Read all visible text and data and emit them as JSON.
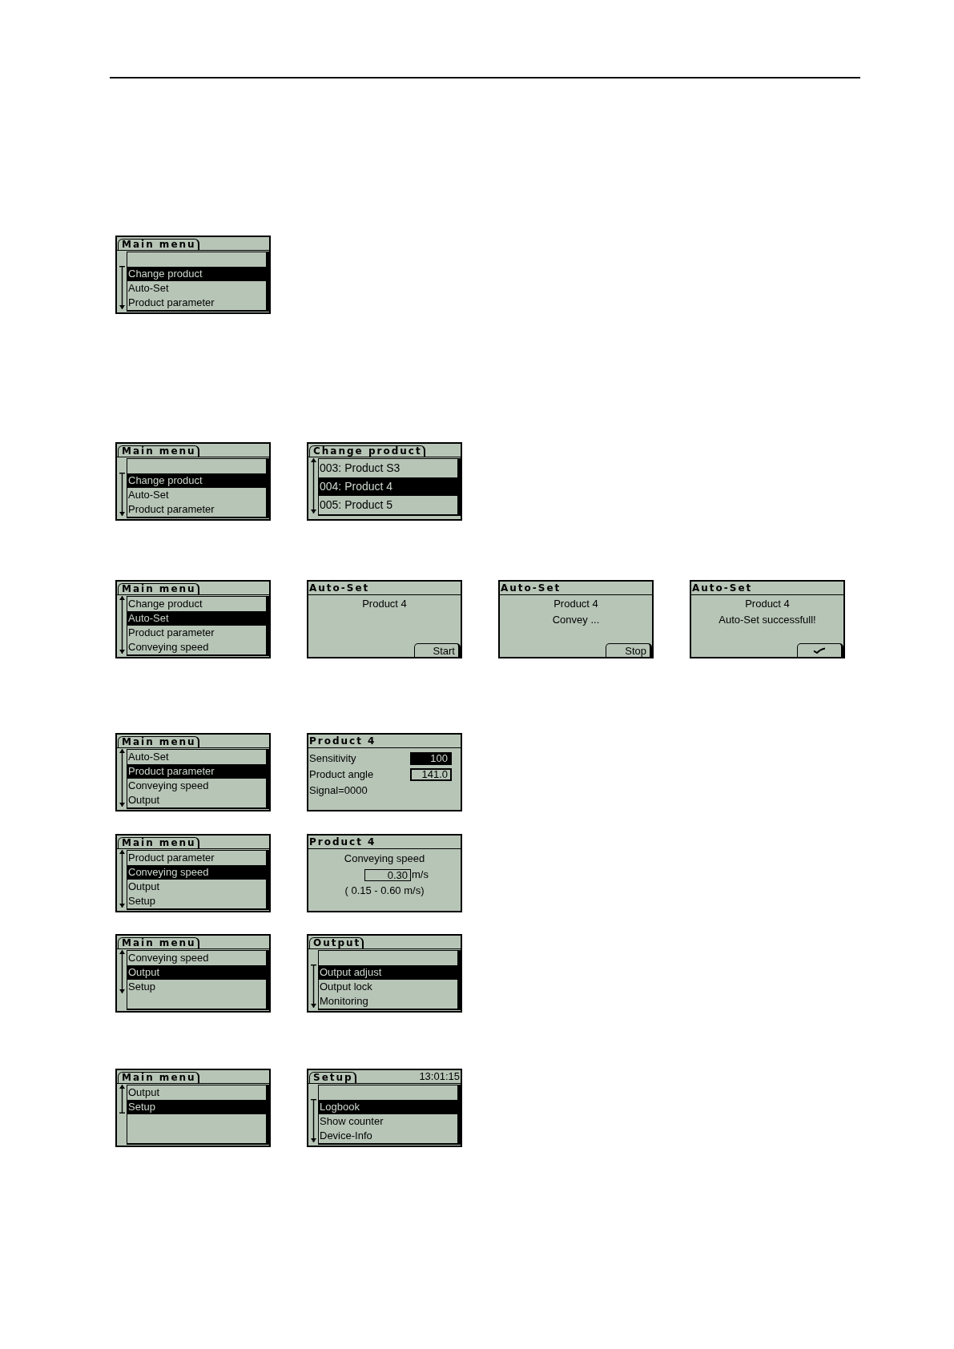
{
  "rows": [
    {
      "screens": [
        {
          "kind": "menu",
          "title": "Main menu",
          "at_top": true,
          "at_end": false,
          "items": [
            {
              "label": "Change product",
              "selected": true
            },
            {
              "label": "Auto-Set",
              "selected": false
            },
            {
              "label": "Product parameter",
              "selected": false
            }
          ]
        }
      ]
    },
    {
      "screens": [
        {
          "kind": "menu",
          "title": "Main menu",
          "at_top": true,
          "at_end": false,
          "items": [
            {
              "label": "Change product",
              "selected": true
            },
            {
              "label": "Auto-Set",
              "selected": false
            },
            {
              "label": "Product parameter",
              "selected": false
            }
          ]
        },
        {
          "kind": "list",
          "title": "Change product",
          "at_top": false,
          "at_end": false,
          "items": [
            {
              "label": "003: Product S3",
              "selected": false
            },
            {
              "label": "004: Product 4",
              "selected": true
            },
            {
              "label": "005: Product 5",
              "selected": false
            }
          ]
        }
      ]
    },
    {
      "screens": [
        {
          "kind": "menu",
          "title": "Main menu",
          "at_top": false,
          "at_end": false,
          "items": [
            {
              "label": "Change product",
              "selected": false
            },
            {
              "label": "Auto-Set",
              "selected": true
            },
            {
              "label": "Product parameter",
              "selected": false
            },
            {
              "label": "Conveying speed",
              "selected": false
            }
          ]
        },
        {
          "kind": "message",
          "title": "Auto-Set",
          "lines": [
            "Product 4"
          ],
          "button": {
            "kind": "text",
            "label": "Start"
          }
        },
        {
          "kind": "message",
          "title": "Auto-Set",
          "lines": [
            "Product 4",
            "Convey ..."
          ],
          "button": {
            "kind": "text",
            "label": "Stop"
          }
        },
        {
          "kind": "message",
          "title": "Auto-Set",
          "lines": [
            "Product 4",
            "Auto-Set successfull!"
          ],
          "button": {
            "kind": "check"
          }
        }
      ]
    },
    {
      "screens": [
        {
          "kind": "menu",
          "title": "Main menu",
          "at_top": false,
          "at_end": false,
          "items": [
            {
              "label": "Auto-Set",
              "selected": false
            },
            {
              "label": "Product parameter",
              "selected": true
            },
            {
              "label": "Conveying speed",
              "selected": false
            },
            {
              "label": "Output",
              "selected": false
            }
          ]
        },
        {
          "kind": "parameters",
          "title": "Product 4",
          "fields": [
            {
              "label": "Sensitivity",
              "value": "100",
              "selected": true
            },
            {
              "label": "Product angle",
              "value": "141.0",
              "selected": false
            }
          ],
          "lines": [
            "Signal=0000"
          ]
        }
      ]
    },
    {
      "screens": [
        {
          "kind": "menu",
          "title": "Main menu",
          "at_top": false,
          "at_end": false,
          "items": [
            {
              "label": "Product parameter",
              "selected": false
            },
            {
              "label": "Conveying speed",
              "selected": true
            },
            {
              "label": "Output",
              "selected": false
            },
            {
              "label": "Setup",
              "selected": false
            }
          ]
        },
        {
          "kind": "setting",
          "title": "Product 4",
          "caption": "Conveying speed",
          "value": "0.30",
          "unit": "m/s",
          "range": "( 0.15 - 0.60 m/s)"
        }
      ]
    },
    {
      "screens": [
        {
          "kind": "menu",
          "title": "Main menu",
          "at_top": false,
          "at_end": false,
          "items": [
            {
              "label": "Conveying speed",
              "selected": false
            },
            {
              "label": "Output",
              "selected": true
            },
            {
              "label": "Setup",
              "selected": false
            }
          ]
        },
        {
          "kind": "menu",
          "title": "Output",
          "at_top": true,
          "at_end": false,
          "items": [
            {
              "label": "Output adjust",
              "selected": true
            },
            {
              "label": "Output lock",
              "selected": false
            },
            {
              "label": "Monitoring",
              "selected": false
            }
          ]
        }
      ]
    },
    {
      "screens": [
        {
          "kind": "menu",
          "title": "Main menu",
          "at_top": false,
          "at_end": true,
          "items": [
            {
              "label": "Output",
              "selected": false
            },
            {
              "label": "Setup",
              "selected": true
            }
          ]
        },
        {
          "kind": "menu",
          "title": "Setup",
          "time": "13:01:15",
          "at_top": true,
          "at_end": false,
          "items": [
            {
              "label": "Logbook",
              "selected": true
            },
            {
              "label": "Show counter",
              "selected": false
            },
            {
              "label": "Device-Info",
              "selected": false
            }
          ]
        }
      ]
    }
  ]
}
